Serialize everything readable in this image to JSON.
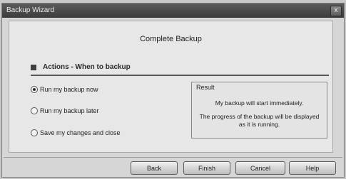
{
  "window": {
    "title": "Backup Wizard",
    "close_glyph": "x"
  },
  "page": {
    "title": "Complete Backup"
  },
  "section": {
    "icon": "square-bullet-icon",
    "heading": "Actions - When to backup"
  },
  "options": [
    {
      "label": "Run my backup now",
      "selected": true
    },
    {
      "label": "Run my backup later",
      "selected": false
    },
    {
      "label": "Save my changes and close",
      "selected": false
    }
  ],
  "result": {
    "title": "Result",
    "line1": "My backup will start immediately.",
    "line2": "The progress of the backup will be displayed as it is running."
  },
  "buttons": {
    "back": "Back",
    "finish": "Finish",
    "cancel": "Cancel",
    "help": "Help"
  }
}
